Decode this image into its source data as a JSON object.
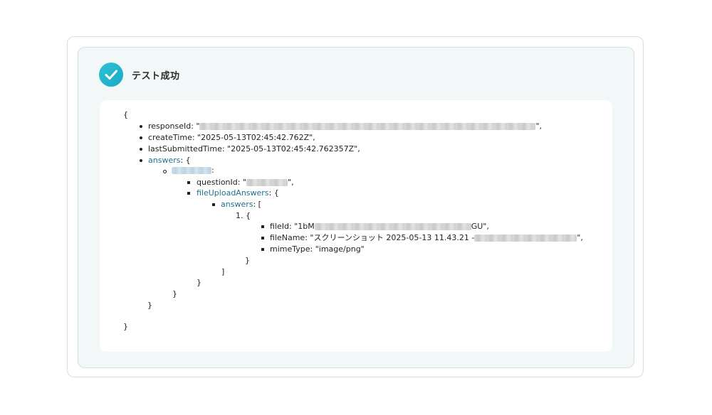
{
  "header": {
    "title": "テスト成功",
    "status_icon": "check-circle-icon",
    "accent": "#22b8cf"
  },
  "json": {
    "open_brace": "{",
    "response_id_label": "responseId: \"",
    "response_id_end": "\",",
    "create_time": "createTime: \"2025-05-13T02:45:42.762Z\",",
    "last_submitted_time": "lastSubmittedTime: \"2025-05-13T02:45:42.762357Z\",",
    "answers_key": "answers",
    "answers_suffix": ": {",
    "question_key_suffix": ":",
    "question_id_label": "questionId: \"",
    "question_id_end": "\",",
    "file_upload_key": "fileUploadAnswers",
    "file_upload_suffix": ": {",
    "inner_answers_key": "answers",
    "inner_answers_suffix": ": [",
    "item_open": "1. {",
    "file_id_start": "fileId: \"1bM",
    "file_id_end": "GU\",",
    "file_name_start": "fileName: \"スクリーンショット 2025-05-13 11.43.21 -",
    "file_name_end": "\",",
    "mime_type": "mimeType: \"image/png\"",
    "close_item": "}",
    "close_array": "]",
    "close_file_upload": "}",
    "close_question": "}",
    "close_answers": "}",
    "close_root": "}"
  }
}
